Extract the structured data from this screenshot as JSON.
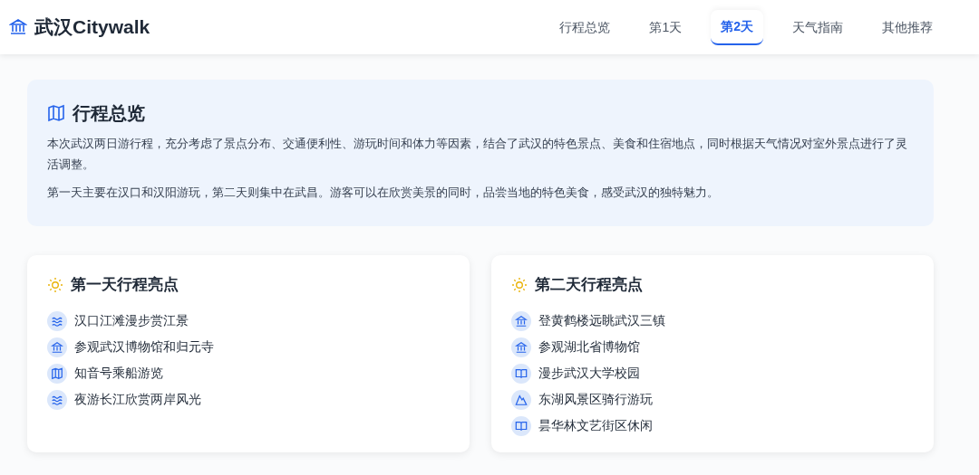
{
  "brand": {
    "title": "武汉Citywalk"
  },
  "nav": [
    {
      "label": "行程总览",
      "selected": false
    },
    {
      "label": "第1天",
      "selected": false
    },
    {
      "label": "第2天",
      "selected": true
    },
    {
      "label": "天气指南",
      "selected": false
    },
    {
      "label": "其他推荐",
      "selected": false
    }
  ],
  "overview": {
    "title": "行程总览",
    "paragraphs": [
      "本次武汉两日游行程，充分考虑了景点分布、交通便利性、游玩时间和体力等因素，结合了武汉的特色景点、美食和住宿地点，同时根据天气情况对室外景点进行了灵活调整。",
      "第一天主要在汉口和汉阳游玩，第二天则集中在武昌。游客可以在欣赏美景的同时，品尝当地的特色美食，感受武汉的独特魅力。"
    ]
  },
  "highlights": [
    {
      "title": "第一天行程亮点",
      "items": [
        {
          "kind": "river",
          "text": "汉口江滩漫步赏江景"
        },
        {
          "kind": "museum",
          "text": "参观武汉博物馆和归元寺"
        },
        {
          "kind": "map",
          "text": "知音号乘船游览"
        },
        {
          "kind": "river",
          "text": "夜游长江欣赏两岸风光"
        }
      ]
    },
    {
      "title": "第二天行程亮点",
      "items": [
        {
          "kind": "museum",
          "text": "登黄鹤楼远眺武汉三镇"
        },
        {
          "kind": "museum",
          "text": "参观湖北省博物馆"
        },
        {
          "kind": "book",
          "text": "漫步武汉大学校园"
        },
        {
          "kind": "mountain",
          "text": "东湖风景区骑行游玩"
        },
        {
          "kind": "book",
          "text": "昙华林文艺街区休闲"
        }
      ]
    }
  ]
}
